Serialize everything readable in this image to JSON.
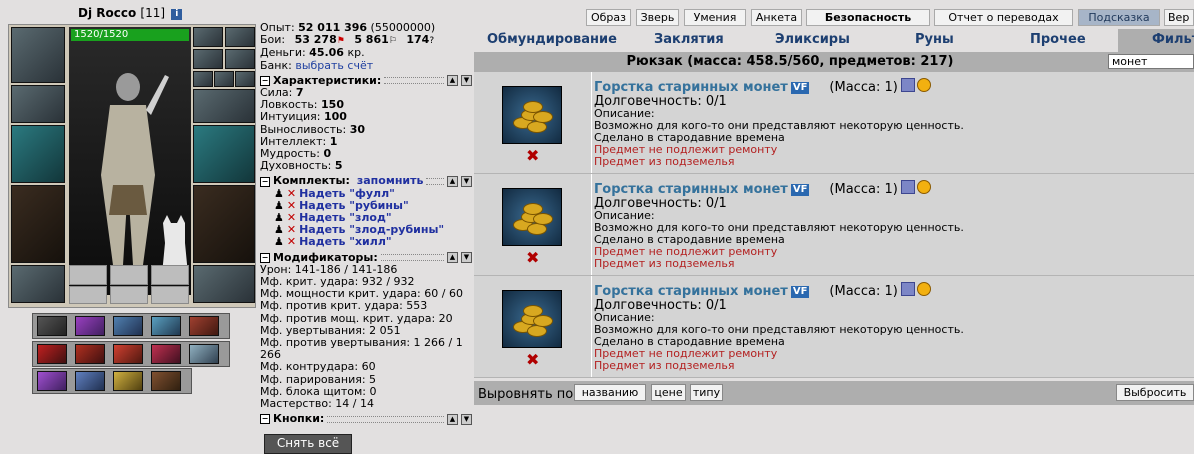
{
  "character": {
    "name": "Dj Rocco",
    "level": "[11]",
    "info_icon": "i",
    "hp": "1520/1520"
  },
  "stats": {
    "exp_label": "Опыт:",
    "exp_value": "52 011 396",
    "exp_next": "(55000000)",
    "fights_label": "Бои:",
    "wins": "53 278",
    "losses": "5 861",
    "draws": "174",
    "money_label": "Деньги:",
    "money_value": "45.06",
    "money_unit": "кр.",
    "bank_label": "Банк:",
    "bank_link": "выбрать счёт",
    "characteristics_title": "Характеристики:",
    "characteristics": [
      {
        "label": "Сила:",
        "value": "7"
      },
      {
        "label": "Ловкость:",
        "value": "150"
      },
      {
        "label": "Интуиция:",
        "value": "100"
      },
      {
        "label": "Выносливость:",
        "value": "30"
      },
      {
        "label": "Интеллект:",
        "value": "1"
      },
      {
        "label": "Мудрость:",
        "value": "0"
      },
      {
        "label": "Духовность:",
        "value": "5"
      }
    ],
    "sets_title": "Комплекты:",
    "sets_remember": "запомнить",
    "sets": [
      "Надеть \"фулл\"",
      "Надеть \"рубины\"",
      "Надеть \"злод\"",
      "Надеть \"злод-рубины\"",
      "Надеть \"хилл\""
    ],
    "modifiers_title": "Модификаторы:",
    "modifiers": [
      "Урон: 141-186 / 141-186",
      "Мф. крит. удара: 932 / 932",
      "Мф. мощности крит. удара: 60 / 60",
      "Мф. против крит. удара: 553",
      "Мф. против мощ. крит. удара: 20",
      "Мф. увертывания: 2 051",
      "Мф. против увертывания: 1 266 / 1",
      "266",
      "Мф. контрудара: 60",
      "Мф. парирования: 5",
      "Мф. блока щитом: 0",
      "Мастерство: 14 / 14"
    ],
    "buttons_title": "Кнопки:",
    "remove_all": "Снять всё"
  },
  "top_menu": [
    "Образ",
    "Зверь",
    "Умения",
    "Анкета",
    "Безопасность",
    "Отчет о переводах",
    "Подсказка",
    "Вер"
  ],
  "inventory": {
    "tabs": [
      "Обмундирование",
      "Заклятия",
      "Эликсиры",
      "Руны",
      "Прочее",
      "Фильт"
    ],
    "bag_title": "Рюкзак (масса: 458.5/560, предметов: 217)",
    "filter_value": "монет",
    "items": [
      {
        "name": "Горстка старинных монет",
        "vf": "VF",
        "mass": "(Масса: 1)",
        "durability": "Долговечность: 0/1",
        "desc_label": "Описание:",
        "desc1": "Возможно для кого-то они представляют некоторую ценность.",
        "desc2": "Сделано в стародавние времена",
        "note1": "Предмет не подлежит ремонту",
        "note2": "Предмет из подземелья"
      },
      {
        "name": "Горстка старинных монет",
        "vf": "VF",
        "mass": "(Масса: 1)",
        "durability": "Долговечность: 0/1",
        "desc_label": "Описание:",
        "desc1": "Возможно для кого-то они представляют некоторую ценность.",
        "desc2": "Сделано в стародавние времена",
        "note1": "Предмет не подлежит ремонту",
        "note2": "Предмет из подземелья"
      },
      {
        "name": "Горстка старинных монет",
        "vf": "VF",
        "mass": "(Масса: 1)",
        "durability": "Долговечность: 0/1",
        "desc_label": "Описание:",
        "desc1": "Возможно для кого-то они представляют некоторую ценность.",
        "desc2": "Сделано в стародавние времена",
        "note1": "Предмет не подлежит ремонту",
        "note2": "Предмет из подземелья"
      }
    ],
    "sort_label": "Выровнять по",
    "sort_buttons": [
      "названию",
      "цене",
      "типу"
    ],
    "throw_button": "Выбросить"
  }
}
